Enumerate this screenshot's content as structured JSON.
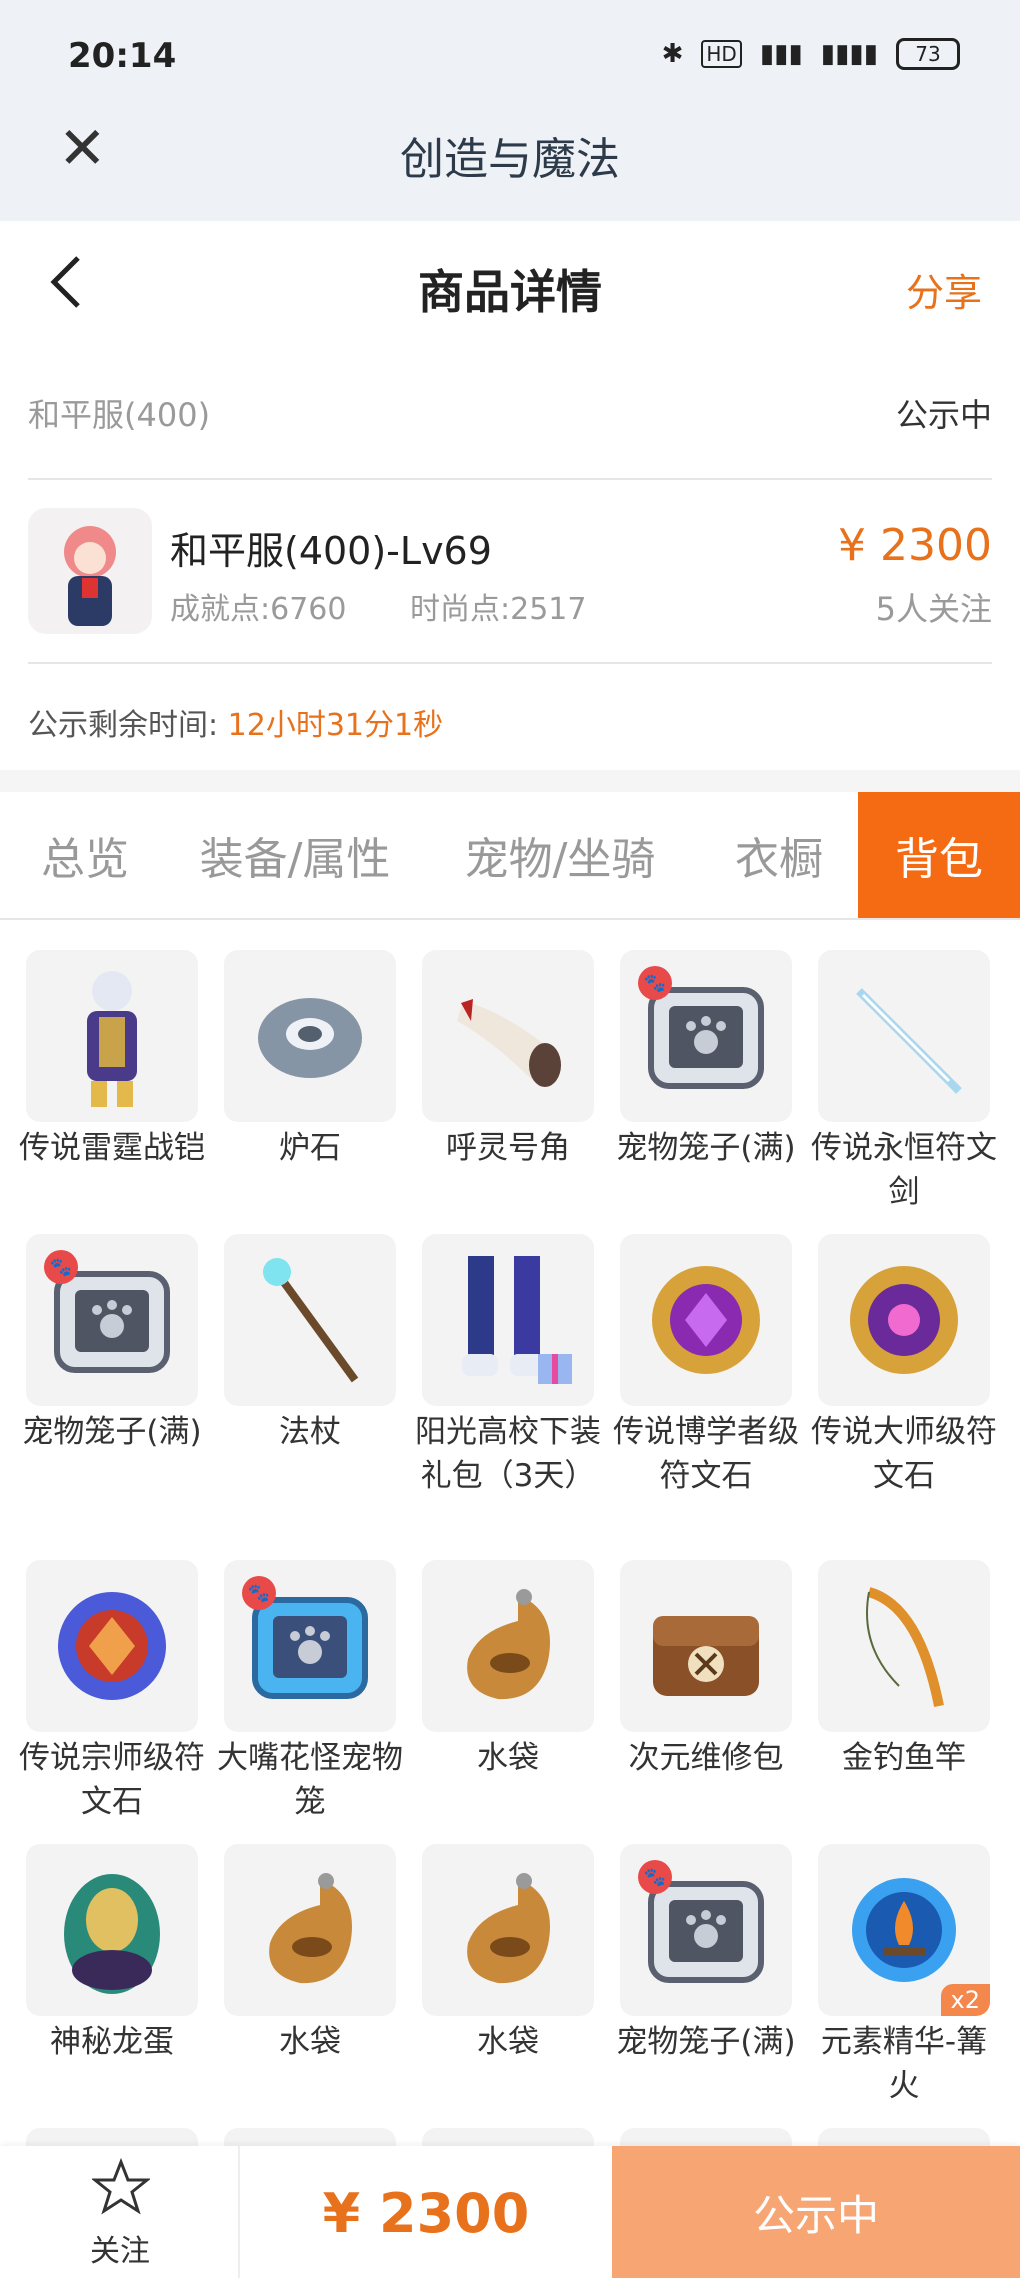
{
  "status_bar": {
    "time": "20:14",
    "battery": "73"
  },
  "app_bar": {
    "title": "创造与魔法"
  },
  "header": {
    "title": "商品详情",
    "share": "分享"
  },
  "server": {
    "name": "和平服(400)",
    "status": "公示中"
  },
  "product": {
    "name": "和平服(400)-Lv69",
    "achievement": "成就点:6760",
    "fashion": "时尚点:2517",
    "price": "¥ 2300",
    "watchers": "5人关注"
  },
  "timer": {
    "label": "公示剩余时间:",
    "value": "12小时31分1秒"
  },
  "tabs": [
    {
      "label": "总览"
    },
    {
      "label": "装备/属性"
    },
    {
      "label": "宠物/坐骑"
    },
    {
      "label": "衣橱"
    },
    {
      "label": "背包"
    }
  ],
  "items": [
    {
      "name": "传说雷霆战铠",
      "icon": "armor-icon"
    },
    {
      "name": "炉石",
      "icon": "hearthstone-icon"
    },
    {
      "name": "呼灵号角",
      "icon": "horn-icon"
    },
    {
      "name": "宠物笼子(满)",
      "icon": "pet-cage-icon"
    },
    {
      "name": "传说永恒符文剑",
      "icon": "sword-icon"
    },
    {
      "name": "宠物笼子(满)",
      "icon": "pet-cage-icon"
    },
    {
      "name": "法杖",
      "icon": "staff-icon"
    },
    {
      "name": "阳光高校下装礼包（3天）",
      "icon": "gift-pants-icon"
    },
    {
      "name": "传说博学者级符文石",
      "icon": "rune-stone-icon"
    },
    {
      "name": "传说大师级符文石",
      "icon": "rune-stone-icon"
    },
    {
      "name": "传说宗师级符文石",
      "icon": "rune-stone-icon"
    },
    {
      "name": "大嘴花怪宠物笼",
      "icon": "blue-cage-icon"
    },
    {
      "name": "水袋",
      "icon": "water-bag-icon"
    },
    {
      "name": "次元维修包",
      "icon": "repair-bag-icon"
    },
    {
      "name": "金钓鱼竿",
      "icon": "fishing-rod-icon"
    },
    {
      "name": "神秘龙蛋",
      "icon": "dragon-egg-icon"
    },
    {
      "name": "水袋",
      "icon": "water-bag-icon"
    },
    {
      "name": "水袋",
      "icon": "water-bag-icon"
    },
    {
      "name": "宠物笼子(满)",
      "icon": "pet-cage-icon"
    },
    {
      "name": "元素精华-篝火",
      "icon": "bonfire-icon",
      "badge": "x2"
    }
  ],
  "bottom": {
    "follow": "关注",
    "price": "¥ 2300",
    "status": "公示中"
  }
}
